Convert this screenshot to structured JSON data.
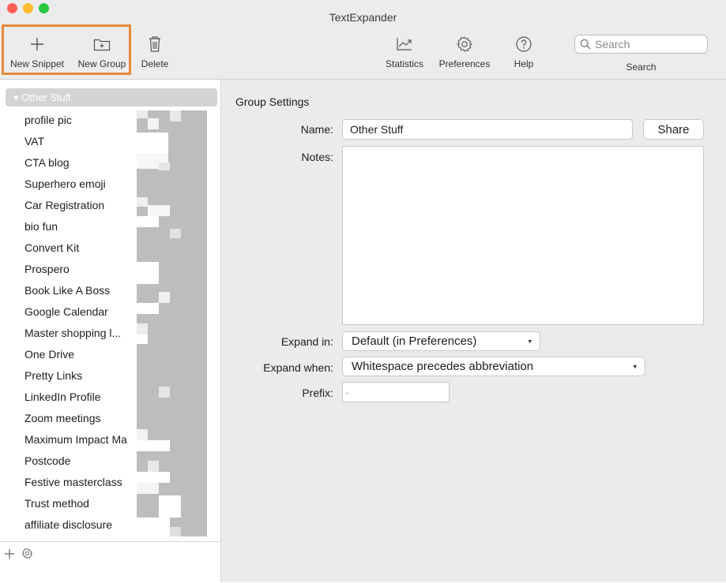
{
  "window": {
    "title": "TextExpander"
  },
  "toolbar": {
    "new_snippet": "New Snippet",
    "new_group": "New Group",
    "delete": "Delete",
    "statistics": "Statistics",
    "preferences": "Preferences",
    "help": "Help",
    "search_placeholder": "Search",
    "search_label": "Search",
    "icons": [
      "plus-icon",
      "new-group-folder-icon",
      "trash-icon",
      "statistics-chart-icon",
      "gear-icon",
      "help-icon",
      "search-icon"
    ]
  },
  "highlight_color": "#e68a3a",
  "sidebar": {
    "group_label": "▾ Other Stuff",
    "items": [
      "profile pic",
      "VAT",
      "CTA blog",
      "Superhero emoji",
      "Car Registration",
      "bio fun",
      "Convert Kit",
      "Prospero",
      "Book Like A Boss",
      "Google Calendar",
      "Master shopping l...",
      "One Drive",
      "Pretty Links",
      "LinkedIn Profile",
      "Zoom meetings",
      "Maximum Impact Ma",
      "Postcode",
      "Festive masterclass",
      "Trust method",
      "affiliate disclosure"
    ],
    "footer_icons": [
      "plus-icon",
      "gear-icon"
    ]
  },
  "group_settings": {
    "heading": "Group Settings",
    "name_label": "Name:",
    "name_value": "Other Stuff",
    "share_label": "Share",
    "notes_label": "Notes:",
    "notes_value": "",
    "expand_in_label": "Expand in:",
    "expand_in_value": "Default (in Preferences)",
    "expand_when_label": "Expand when:",
    "expand_when_value": "Whitespace precedes abbreviation",
    "prefix_label": "Prefix:",
    "prefix_placeholder": "-"
  }
}
